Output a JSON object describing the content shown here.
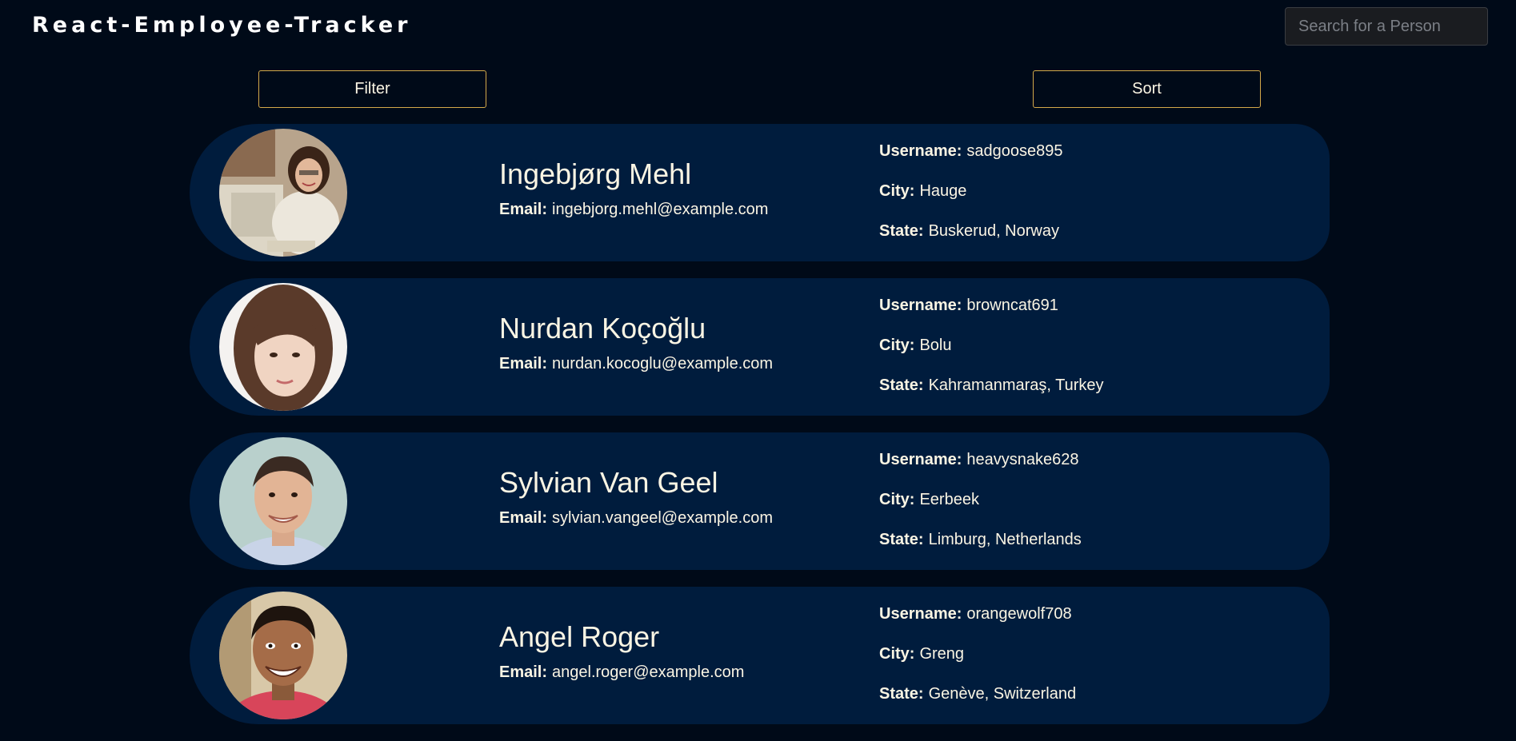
{
  "header": {
    "title": "React-Employee-Tracker",
    "search_placeholder": "Search for a Person"
  },
  "controls": {
    "filter_label": "Filter",
    "sort_label": "Sort"
  },
  "labels": {
    "email": "Email:",
    "username": "Username:",
    "city": "City:",
    "state": "State:"
  },
  "employees": [
    {
      "name": "Ingebjørg Mehl",
      "email": "ingebjorg.mehl@example.com",
      "username": "sadgoose895",
      "city": "Hauge",
      "state": "Buskerud, Norway",
      "avatar_icon": "person-photo-icon"
    },
    {
      "name": "Nurdan Koçoğlu",
      "email": "nurdan.kocoglu@example.com",
      "username": "browncat691",
      "city": "Bolu",
      "state": "Kahramanmaraş, Turkey",
      "avatar_icon": "person-photo-icon"
    },
    {
      "name": "Sylvian Van Geel",
      "email": "sylvian.vangeel@example.com",
      "username": "heavysnake628",
      "city": "Eerbeek",
      "state": "Limburg, Netherlands",
      "avatar_icon": "person-photo-icon"
    },
    {
      "name": "Angel Roger",
      "email": "angel.roger@example.com",
      "username": "orangewolf708",
      "city": "Greng",
      "state": "Genève, Switzerland",
      "avatar_icon": "person-photo-icon"
    }
  ],
  "colors": {
    "background": "#000a18",
    "card": "#001c3d",
    "button_border": "#d4a94a",
    "text": "#fbf5e4"
  }
}
